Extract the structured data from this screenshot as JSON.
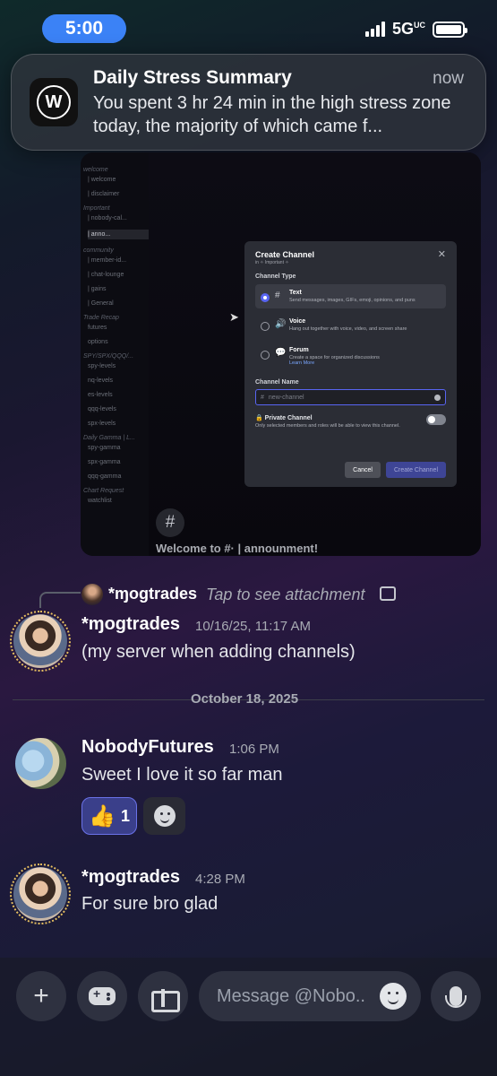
{
  "status_bar": {
    "time": "5:00",
    "network": "5G",
    "network_sup": "UC"
  },
  "notification": {
    "title": "Daily Stress Summary",
    "time": "now",
    "body": "You spent 3 hr 24 min in the high stress zone today, the majority of which came f...",
    "app_icon_letter": "W"
  },
  "attachment": {
    "sidebar": {
      "items": [
        {
          "type": "cat",
          "label": "welcome"
        },
        {
          "type": "ch",
          "label": "| welcome"
        },
        {
          "type": "ch",
          "label": "| disclaimer"
        },
        {
          "type": "cat",
          "label": "Important"
        },
        {
          "type": "ch",
          "label": "| nobody-cal..."
        },
        {
          "type": "ch",
          "label": "| anno...",
          "active": true
        },
        {
          "type": "cat",
          "label": "community"
        },
        {
          "type": "ch",
          "label": "| member-id..."
        },
        {
          "type": "ch",
          "label": "| chat-lounge"
        },
        {
          "type": "ch",
          "label": "| gains"
        },
        {
          "type": "ch",
          "label": "| General"
        },
        {
          "type": "cat",
          "label": "Trade Recap"
        },
        {
          "type": "ch",
          "label": "futures"
        },
        {
          "type": "ch",
          "label": "options"
        },
        {
          "type": "cat",
          "label": "SPY/SPX/QQQ/..."
        },
        {
          "type": "ch",
          "label": "spy-levels"
        },
        {
          "type": "ch",
          "label": "nq-levels"
        },
        {
          "type": "ch",
          "label": "es-levels"
        },
        {
          "type": "ch",
          "label": "qqq-levels"
        },
        {
          "type": "ch",
          "label": "spx-levels"
        },
        {
          "type": "cat",
          "label": "Daily Gamma | L..."
        },
        {
          "type": "ch",
          "label": "spy-gamma"
        },
        {
          "type": "ch",
          "label": "spx-gamma"
        },
        {
          "type": "ch",
          "label": "qqq-gamma"
        },
        {
          "type": "cat",
          "label": "Chart Request"
        },
        {
          "type": "ch",
          "label": "watchlist"
        }
      ]
    },
    "modal": {
      "title": "Create Channel",
      "subtitle": "in ✧ Important ✧",
      "close": "✕",
      "channel_type_label": "Channel Type",
      "options": [
        {
          "icon": "#",
          "name": "Text",
          "desc": "Send messages, images, GIFs, emoji, opinions, and puns",
          "link": "",
          "selected": true
        },
        {
          "icon": "🔊",
          "name": "Voice",
          "desc": "Hang out together with voice, video, and screen share",
          "link": "",
          "selected": false
        },
        {
          "icon": "💬",
          "name": "Forum",
          "desc": "Create a space for organized discussions",
          "link": "Learn More",
          "selected": false
        }
      ],
      "channel_name_label": "Channel Name",
      "channel_name_placeholder": "new-channel",
      "private_title": "Private Channel",
      "private_desc": "Only selected members and roles will be able to view this channel.",
      "cancel": "Cancel",
      "create": "Create Channel"
    },
    "welcome_text": "Welcome to #· | announment!"
  },
  "reply": {
    "name": "*ɱogtrades",
    "tap_text": "Tap to see attachment"
  },
  "messages": [
    {
      "name": "*ɱogtrades",
      "time": "10/16/25, 11:17 AM",
      "text": "(my server when adding channels)"
    },
    {
      "name": "NobodyFutures",
      "time": "1:06 PM",
      "text": "Sweet I love it so far man"
    },
    {
      "name": "*ɱogtrades",
      "time": "4:28 PM",
      "text": "For sure bro glad"
    }
  ],
  "date_divider": "October 18, 2025",
  "reaction": {
    "emoji": "👍",
    "count": "1"
  },
  "composer": {
    "placeholder": "Message @Nobo.."
  },
  "colors": {
    "accent": "#5865f2",
    "status_pill": "#3b82f6",
    "reaction_bg": "#3a3f8a"
  }
}
